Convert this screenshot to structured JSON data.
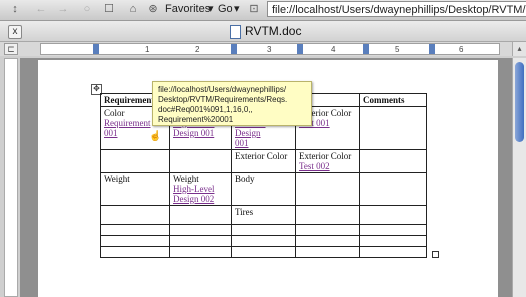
{
  "toolbar": {
    "favorites_label": "Favorites",
    "go_label": "Go",
    "address": "file://localhost/Users/dwaynephillips/Desktop/RVTM/RVTM.doc"
  },
  "window": {
    "title": "RVTM.doc",
    "close_glyph": "x"
  },
  "ruler": {
    "numbers": [
      "1",
      "2",
      "3",
      "4",
      "5",
      "6"
    ]
  },
  "tooltip": {
    "lines": [
      "file://localhost/Users/dwaynephillips/",
      "Desktop/RVTM/Requirements/Reqs.",
      "doc#Req001%091,1,16,0,,",
      "Requirement%20001"
    ]
  },
  "table": {
    "headers": [
      "Requirement",
      "",
      "",
      "",
      "Comments"
    ],
    "rows": [
      [
        "Color",
        "",
        "",
        "Exterior Color",
        ""
      ],
      [
        "",
        "",
        "Exterior Color",
        "Exterior Color",
        ""
      ],
      [
        "Weight",
        "Weight",
        "Body",
        "",
        ""
      ],
      [
        "",
        "",
        "Tires",
        "",
        ""
      ]
    ],
    "links": {
      "r1c1": "Requirement 001",
      "r1c2a": "High-Level",
      "r1c2b": "Design 001",
      "r1c3a": "Detailed Design",
      "r1c3b": "001",
      "r1c4": "Test 001",
      "r2c4": "Test 002",
      "r3c2a": "High-Level",
      "r3c2b": "Design 002"
    }
  },
  "colors": {
    "link": "#7a2f8c",
    "tooltip_bg": "#fffdc4",
    "thumb": "#3f6fc1"
  }
}
